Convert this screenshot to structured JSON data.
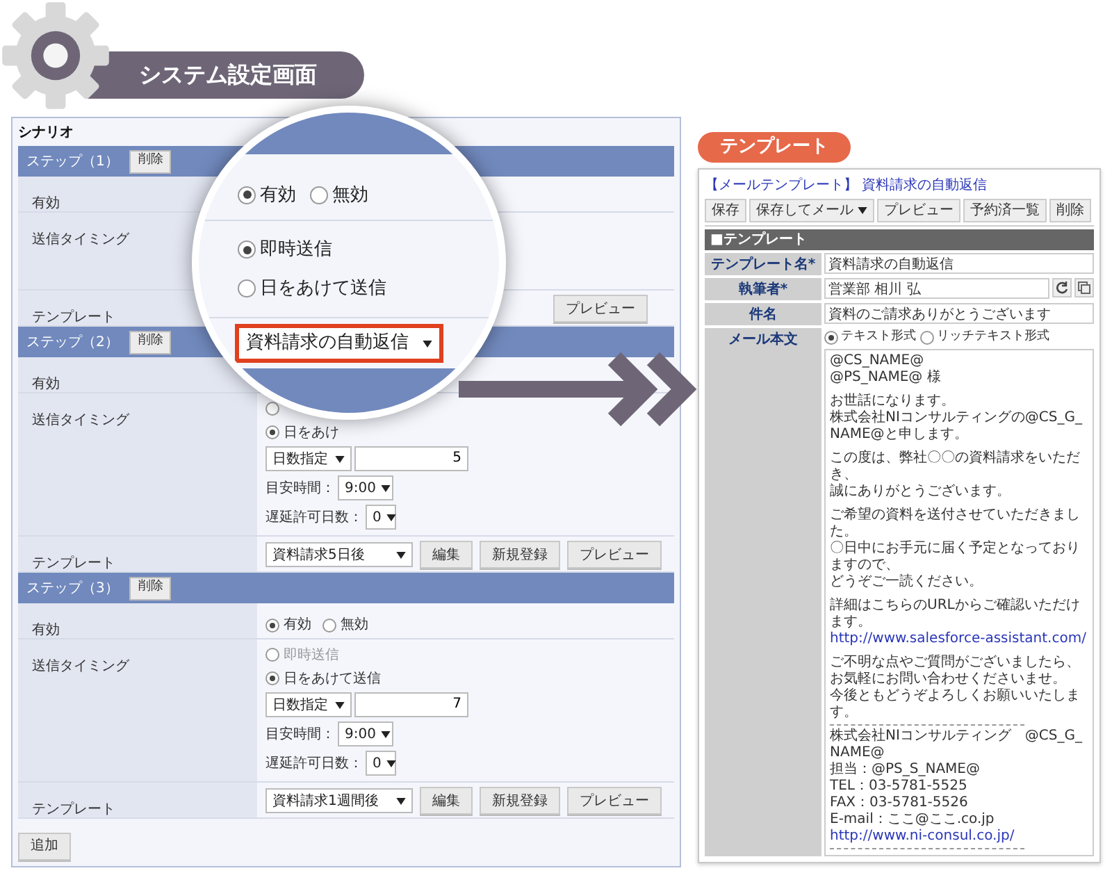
{
  "header": {
    "title": "システム設定画面"
  },
  "scenario": {
    "title": "シナリオ",
    "add_button": "追加",
    "steps": [
      {
        "label": "ステップ（1）",
        "delete_button": "削除",
        "rows": [
          {
            "kind": "enabled",
            "label": "有効"
          },
          {
            "kind": "timing",
            "label": "送信タイミング"
          },
          {
            "kind": "template",
            "label": "テンプレート",
            "buttons": [
              "プレビュー"
            ]
          }
        ]
      },
      {
        "label": "ステップ（2）",
        "delete_button": "削除",
        "rows": [
          {
            "kind": "enabled",
            "label": "有効"
          },
          {
            "kind": "timing",
            "label": "送信タイミング",
            "options": [
              {
                "selected": false
              },
              {
                "label": "日をあけ",
                "selected": true
              }
            ],
            "day_mode": "日数指定",
            "days": "5",
            "time_label": "目安時間：",
            "time": "9:00",
            "delay_label": "遅延許可日数：",
            "delay": "0"
          },
          {
            "kind": "template",
            "label": "テンプレート",
            "select": "資料請求5日後",
            "buttons": [
              "編集",
              "新規登録",
              "プレビュー"
            ]
          }
        ]
      },
      {
        "label": "ステップ（3）",
        "delete_button": "削除",
        "rows": [
          {
            "kind": "enabled",
            "label": "有効",
            "options": [
              {
                "label": "有効",
                "selected": true
              },
              {
                "label": "無効",
                "selected": false
              }
            ]
          },
          {
            "kind": "timing",
            "label": "送信タイミング",
            "options": [
              {
                "label": "即時送信",
                "selected": false
              },
              {
                "label": "日をあけて送信",
                "selected": true
              }
            ],
            "day_mode": "日数指定",
            "days": "7",
            "time_label": "目安時間：",
            "time": "9:00",
            "delay_label": "遅延許可日数：",
            "delay": "0"
          },
          {
            "kind": "template",
            "label": "テンプレート",
            "select": "資料請求1週間後",
            "buttons": [
              "編集",
              "新規登録",
              "プレビュー"
            ]
          }
        ]
      }
    ]
  },
  "magnifier": {
    "enabled_options": [
      {
        "label": "有効",
        "selected": true
      },
      {
        "label": "無効",
        "selected": false
      }
    ],
    "timing_options": [
      {
        "label": "即時送信",
        "selected": true
      },
      {
        "label": "日をあけて送信",
        "selected": false
      }
    ],
    "template_select": "資料請求の自動返信"
  },
  "template_preview": {
    "badge": "テンプレート",
    "link": "【メールテンプレート】 資料請求の自動返信",
    "toolbar": [
      {
        "label": "保存",
        "dropdown": false
      },
      {
        "label": "保存してメール",
        "dropdown": true
      },
      {
        "label": "プレビュー",
        "dropdown": false
      },
      {
        "label": "予約済一覧",
        "dropdown": false
      },
      {
        "label": "削除",
        "dropdown": false
      }
    ],
    "section": "■テンプレート",
    "fields": [
      {
        "kind": "text",
        "label": "テンプレート名*",
        "value": "資料請求の自動返信"
      },
      {
        "kind": "author",
        "label": "執筆者*",
        "value": "営業部 相川 弘"
      },
      {
        "kind": "text",
        "label": "件名",
        "value": "資料のご請求ありがとうございます"
      },
      {
        "kind": "body",
        "label": "メール本文",
        "formats": [
          {
            "label": "テキスト形式",
            "selected": true
          },
          {
            "label": "リッチテキスト形式",
            "selected": false
          }
        ],
        "lines": [
          {
            "kind": "text",
            "text": "@CS_NAME@"
          },
          {
            "kind": "text",
            "text": "@PS_NAME@ 様"
          },
          {
            "kind": "gap"
          },
          {
            "kind": "text",
            "text": "お世話になります。"
          },
          {
            "kind": "text",
            "text": "株式会社NIコンサルティングの@CS_G_NAME@と申します。"
          },
          {
            "kind": "gap"
          },
          {
            "kind": "text",
            "text": "この度は、弊社〇〇の資料請求をいただき、"
          },
          {
            "kind": "text",
            "text": "誠にありがとうございます。"
          },
          {
            "kind": "gap"
          },
          {
            "kind": "text",
            "text": "ご希望の資料を送付させていただきました。"
          },
          {
            "kind": "text",
            "text": "〇日中にお手元に届く予定となっておりますので、"
          },
          {
            "kind": "text",
            "text": "どうぞご一読ください。"
          },
          {
            "kind": "gap"
          },
          {
            "kind": "text",
            "text": "詳細はこちらのURLからご確認いただけます。"
          },
          {
            "kind": "link",
            "text": "http://www.salesforce-assistant.com/"
          },
          {
            "kind": "gap"
          },
          {
            "kind": "text",
            "text": "ご不明な点やご質問がございましたら、"
          },
          {
            "kind": "text",
            "text": "お気軽にお問い合わせくださいませ。"
          },
          {
            "kind": "text",
            "text": "今後ともどうぞよろしくお願いいたします。"
          },
          {
            "kind": "rule"
          },
          {
            "kind": "text",
            "text": "株式会社NIコンサルティング　@CS_G_NAME@"
          },
          {
            "kind": "text",
            "text": "担当：@PS_S_NAME@"
          },
          {
            "kind": "text",
            "text": "TEL：03-5781-5525"
          },
          {
            "kind": "text",
            "text": "FAX：03-5781-5526"
          },
          {
            "kind": "text",
            "text": "E-mail：ここ@ここ.co.jp"
          },
          {
            "kind": "link",
            "text": "http://www.ni-consul.co.jp/"
          },
          {
            "kind": "rule"
          }
        ]
      }
    ]
  }
}
